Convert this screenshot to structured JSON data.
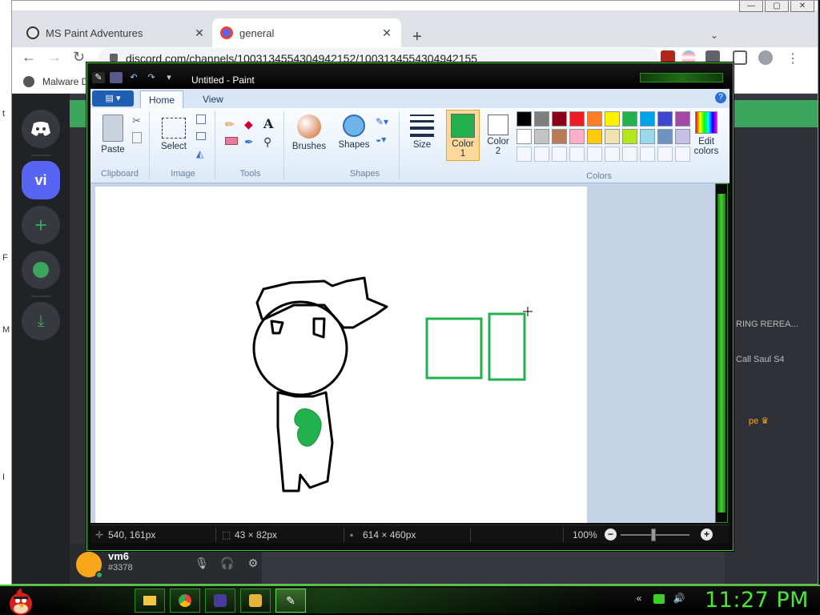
{
  "desktop": {
    "edge_glyphs": [
      "t",
      "F",
      "M",
      "I"
    ]
  },
  "chrome": {
    "tabs": [
      {
        "title": "MS Paint Adventures",
        "active": false
      },
      {
        "title": "general",
        "active": true
      }
    ],
    "new_tab": "+",
    "tab_search": "⌄",
    "close_glyph": "✕",
    "window_controls": {
      "minimize": "—",
      "maximize": "▢",
      "close": "✕"
    },
    "nav": {
      "back": "←",
      "forward": "→",
      "reload": "↻"
    },
    "url": "discord.com/channels/1003134554304942152/1003134554304942155",
    "bookmarks": [
      {
        "label": "Malware D"
      }
    ]
  },
  "discord": {
    "guild_vi": "vi",
    "add_server": "+",
    "help": "?",
    "right_panel": {
      "item1": "RING REREA...",
      "item2": "Call Saul S4",
      "crown": "pe ♛"
    },
    "user": {
      "name": "vm6",
      "tag": "#3378"
    }
  },
  "paint": {
    "title": "Untitled - Paint",
    "app_menu": "▤ ▾",
    "tabs": {
      "home": "Home",
      "view": "View"
    },
    "help": "?",
    "groups": {
      "clipboard": "Clipboard",
      "image": "Image",
      "tools": "Tools",
      "shapes": "Shapes",
      "colors": "Colors"
    },
    "buttons": {
      "paste": "Paste",
      "select": "Select",
      "brushes": "Brushes",
      "shapes": "Shapes",
      "size": "Size",
      "color1_line1": "Color",
      "color1_line2": "1",
      "color2_line1": "Color",
      "color2_line2": "2",
      "edit_colors_line1": "Edit",
      "edit_colors_line2": "colors"
    },
    "palette_row1": [
      "#000000",
      "#7f7f7f",
      "#880015",
      "#ed1c24",
      "#ff7f27",
      "#fff200",
      "#22b14c",
      "#00a2e8",
      "#3f48cc",
      "#a349a4"
    ],
    "palette_row2": [
      "#ffffff",
      "#c3c3c3",
      "#b97a57",
      "#ffaec9",
      "#ffc90e",
      "#efe4b0",
      "#b5e61d",
      "#99d9ea",
      "#7092be",
      "#c8bfe7"
    ],
    "primary_color": "#22b14c",
    "status": {
      "cursor": "540, 161px",
      "selection": "43 × 82px",
      "canvas_size": "614 × 460px",
      "zoom": "100%"
    }
  },
  "taskbar": {
    "clock": "11:27 PM"
  }
}
